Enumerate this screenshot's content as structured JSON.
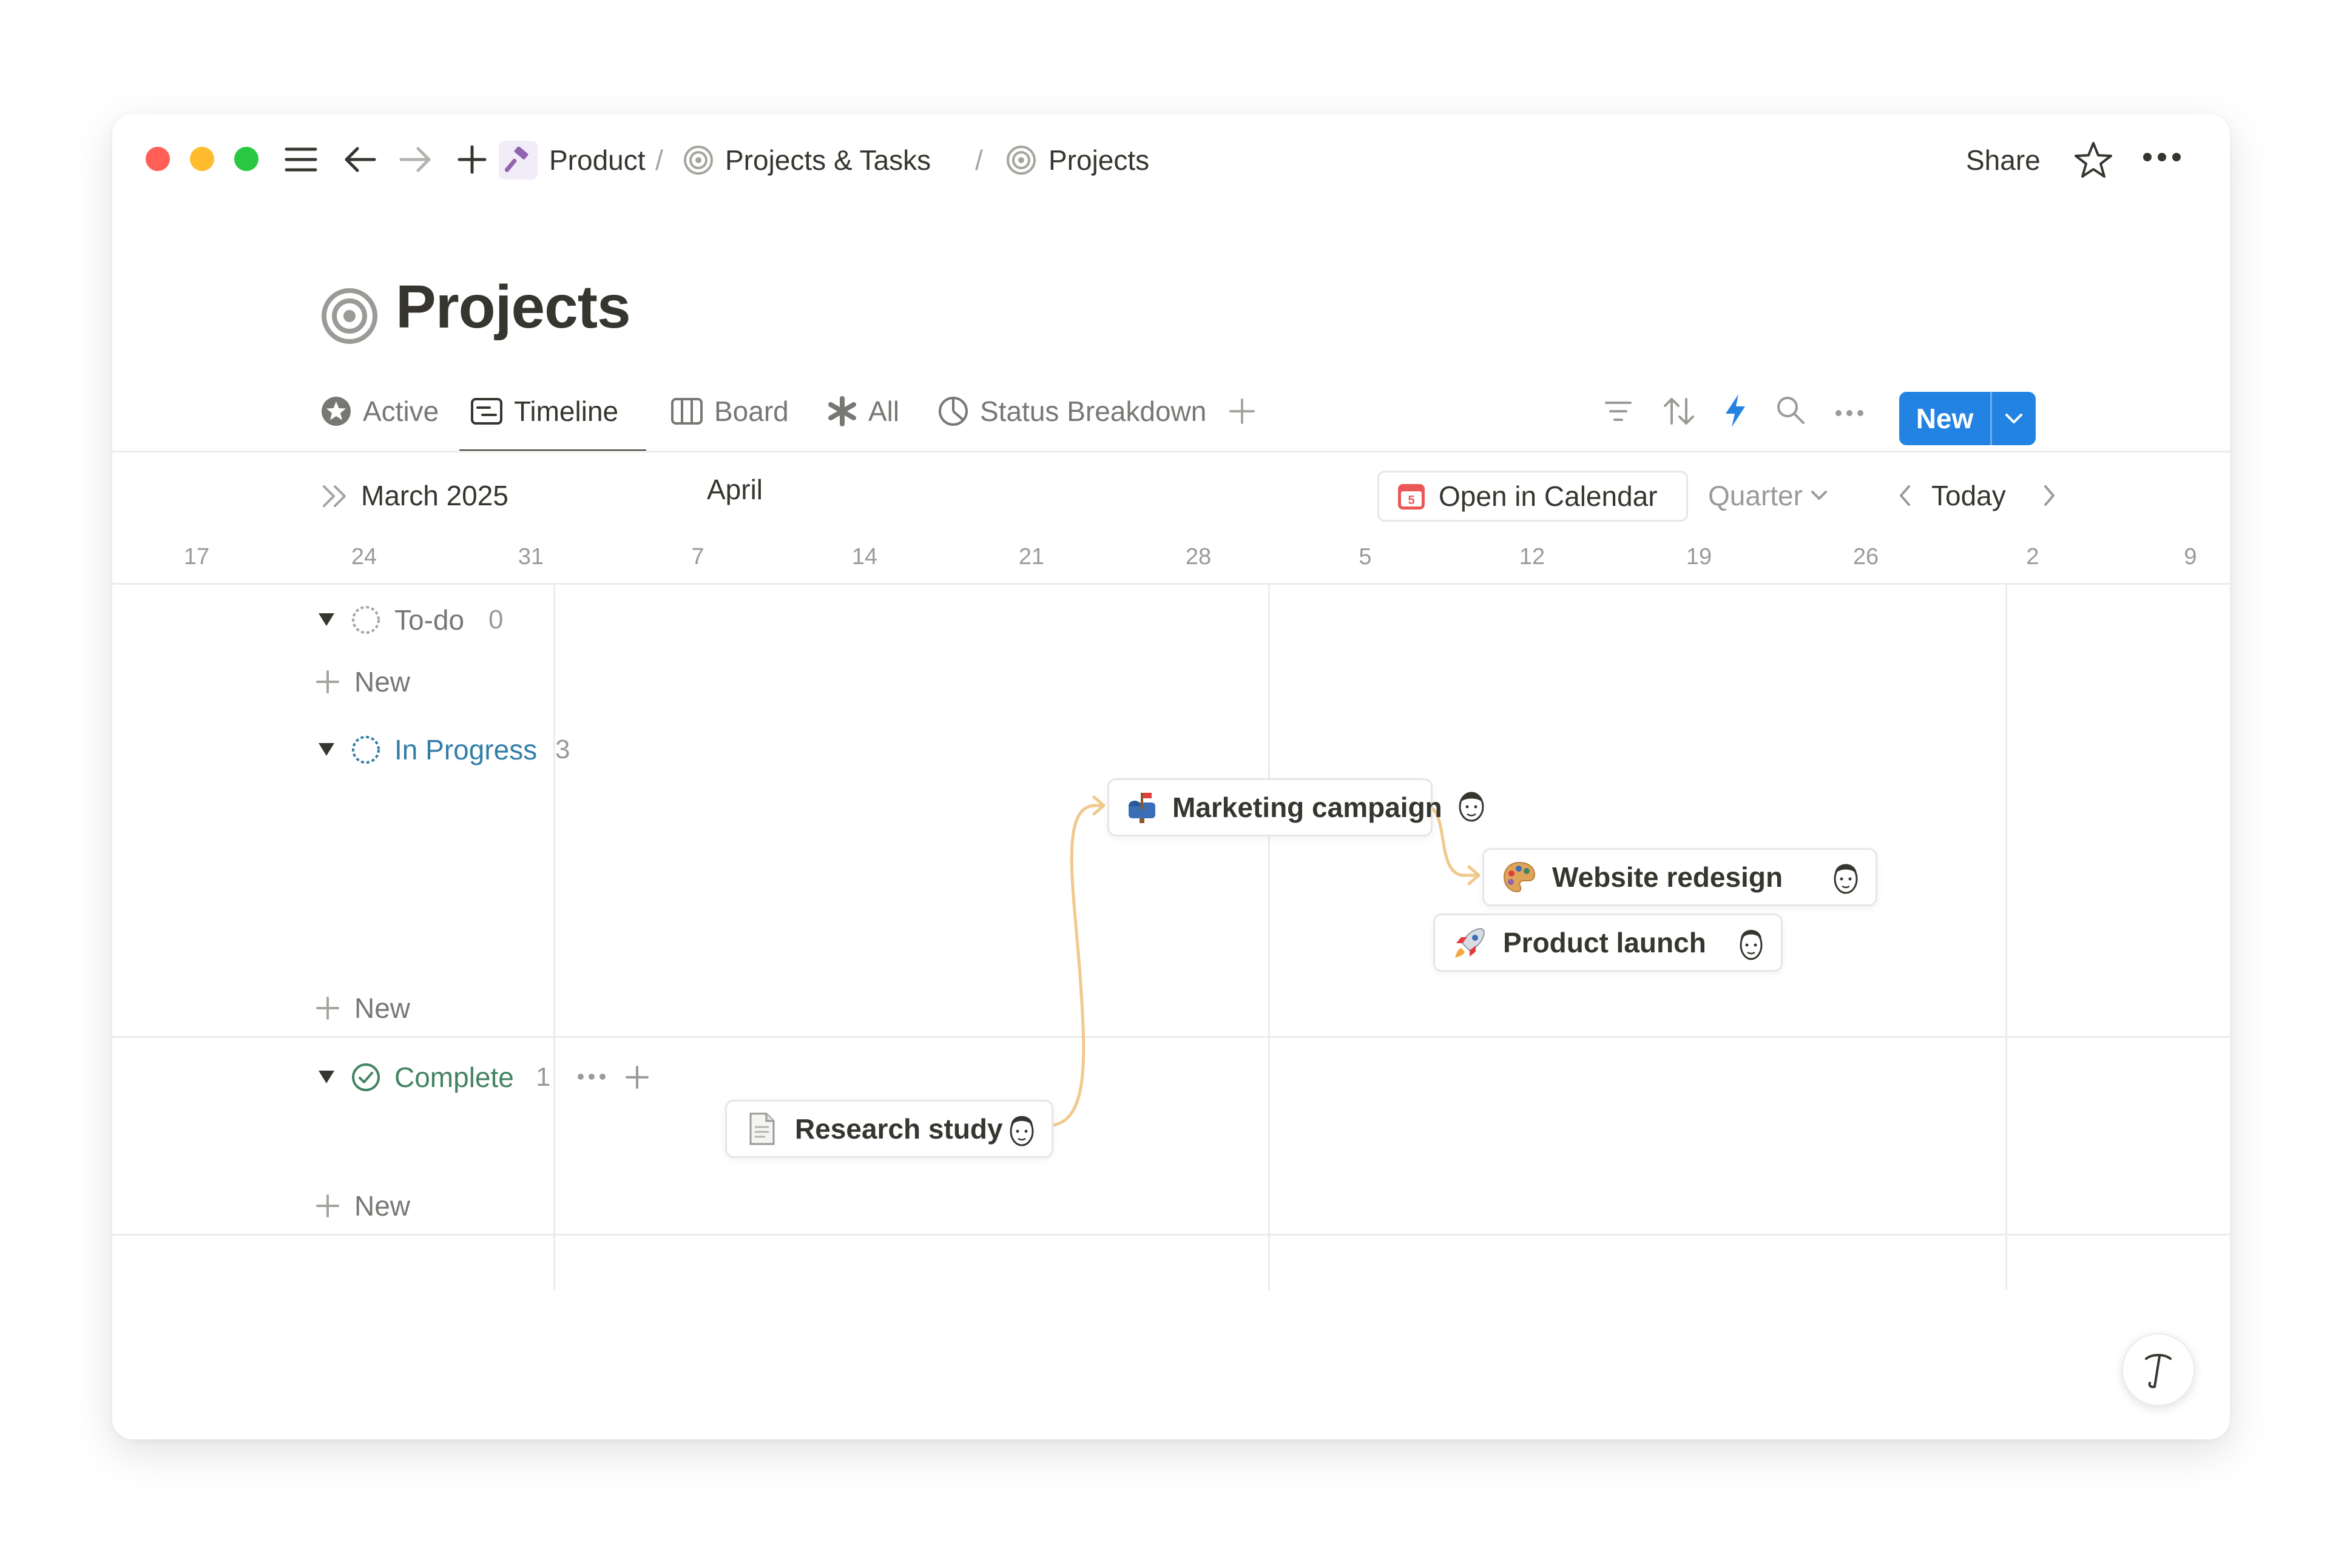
{
  "window": {
    "traffic_lights": {
      "close": "#ff5f57",
      "minimize": "#febc2e",
      "maximize": "#28c840"
    }
  },
  "breadcrumb": {
    "items": [
      {
        "label": "Product",
        "icon": "hammer-icon"
      },
      {
        "label": "Projects & Tasks",
        "icon": "target-icon"
      },
      {
        "label": "Projects",
        "icon": "target-icon"
      }
    ],
    "separator": "/"
  },
  "topbar": {
    "share_label": "Share"
  },
  "page": {
    "title": "Projects",
    "icon": "target-icon"
  },
  "views": {
    "tabs": [
      {
        "label": "Active",
        "icon": "star-circle-icon",
        "active": false
      },
      {
        "label": "Timeline",
        "icon": "timeline-icon",
        "active": true
      },
      {
        "label": "Board",
        "icon": "board-icon",
        "active": false
      },
      {
        "label": "All",
        "icon": "asterisk-icon",
        "active": false
      },
      {
        "label": "Status Breakdown",
        "icon": "pie-chart-icon",
        "active": false
      }
    ],
    "new_label": "New"
  },
  "timeline": {
    "months": [
      "March 2025",
      "April"
    ],
    "open_calendar_label": "Open in Calendar",
    "calendar_icon_number": "5",
    "zoom_label": "Quarter",
    "today_label": "Today",
    "dates": [
      "17",
      "24",
      "31",
      "7",
      "14",
      "21",
      "28",
      "5",
      "12",
      "19",
      "26",
      "2",
      "9"
    ]
  },
  "groups": {
    "todo": {
      "label": "To-do",
      "count": "0",
      "color": "#787774"
    },
    "in_progress": {
      "label": "In Progress",
      "count": "3",
      "color": "#337ea9"
    },
    "complete": {
      "label": "Complete",
      "count": "1",
      "color": "#448361"
    },
    "new_label": "New"
  },
  "items": {
    "marketing": {
      "label": "Marketing campaign",
      "icon": "mailbox-icon"
    },
    "website": {
      "label": "Website redesign",
      "icon": "palette-icon"
    },
    "launch": {
      "label": "Product launch",
      "icon": "rocket-icon"
    },
    "research": {
      "label": "Research study",
      "icon": "document-icon"
    }
  },
  "colors": {
    "accent": "#2383e2",
    "dependency": "#f0c98c"
  }
}
